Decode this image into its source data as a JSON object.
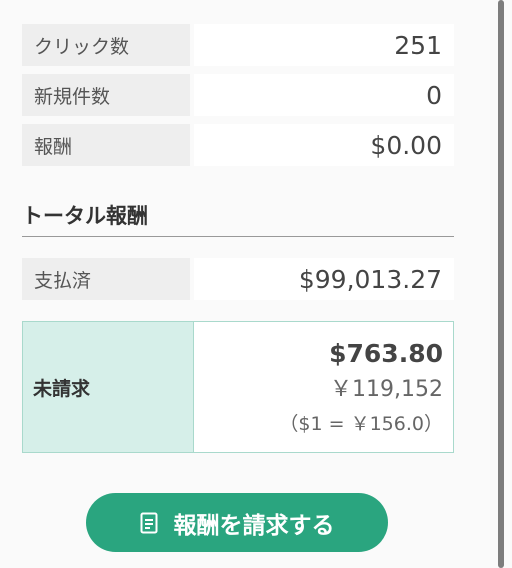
{
  "stats": [
    {
      "label": "クリック数",
      "value": "251"
    },
    {
      "label": "新規件数",
      "value": "0"
    },
    {
      "label": "報酬",
      "value": "$0.00"
    }
  ],
  "total": {
    "title": "トータル報酬",
    "paid_label": "支払済",
    "paid_value": "$99,013.27",
    "unbilled_label": "未請求",
    "unbilled_usd": "$763.80",
    "unbilled_jpy": "￥119,152",
    "rate": "（$1 = ￥156.0）"
  },
  "cta": {
    "label": "報酬を請求する",
    "icon": "document-icon"
  },
  "colors": {
    "accent": "#2aa57f",
    "highlight": "#d6efe9"
  }
}
